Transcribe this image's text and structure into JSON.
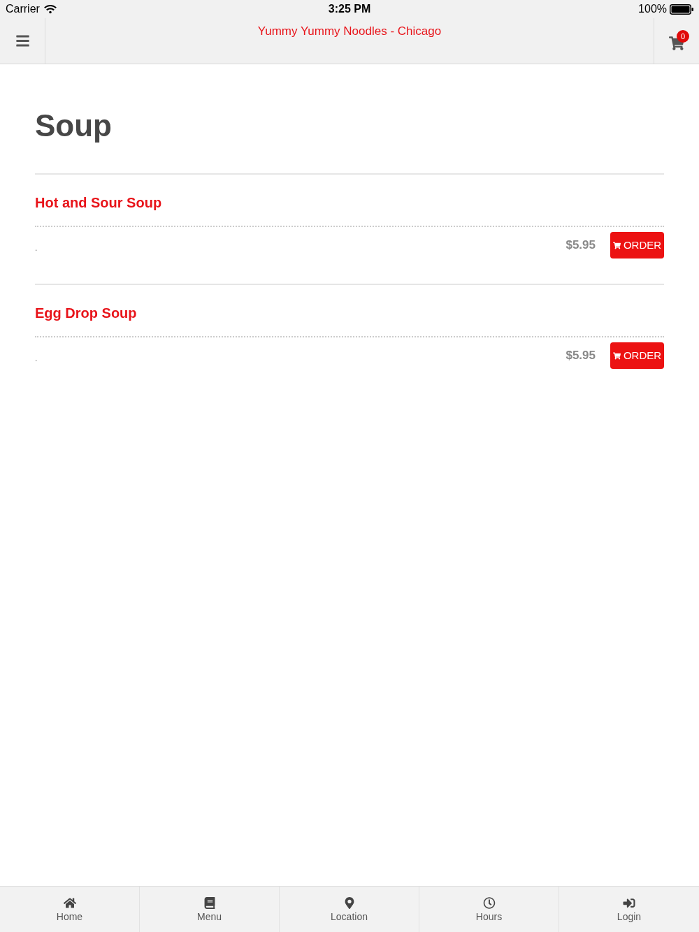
{
  "status_bar": {
    "carrier": "Carrier",
    "time": "3:25 PM",
    "battery": "100%"
  },
  "header": {
    "title": "Yummy Yummy Noodles - Chicago",
    "cart_count": "0"
  },
  "section": {
    "title": "Soup"
  },
  "items": [
    {
      "name": "Hot and Sour Soup",
      "description": ".",
      "price": "$5.95",
      "button": "ORDER"
    },
    {
      "name": "Egg Drop Soup",
      "description": ".",
      "price": "$5.95",
      "button": "ORDER"
    }
  ],
  "tab_bar": [
    {
      "label": "Home"
    },
    {
      "label": "Menu"
    },
    {
      "label": "Location"
    },
    {
      "label": "Hours"
    },
    {
      "label": "Login"
    }
  ]
}
